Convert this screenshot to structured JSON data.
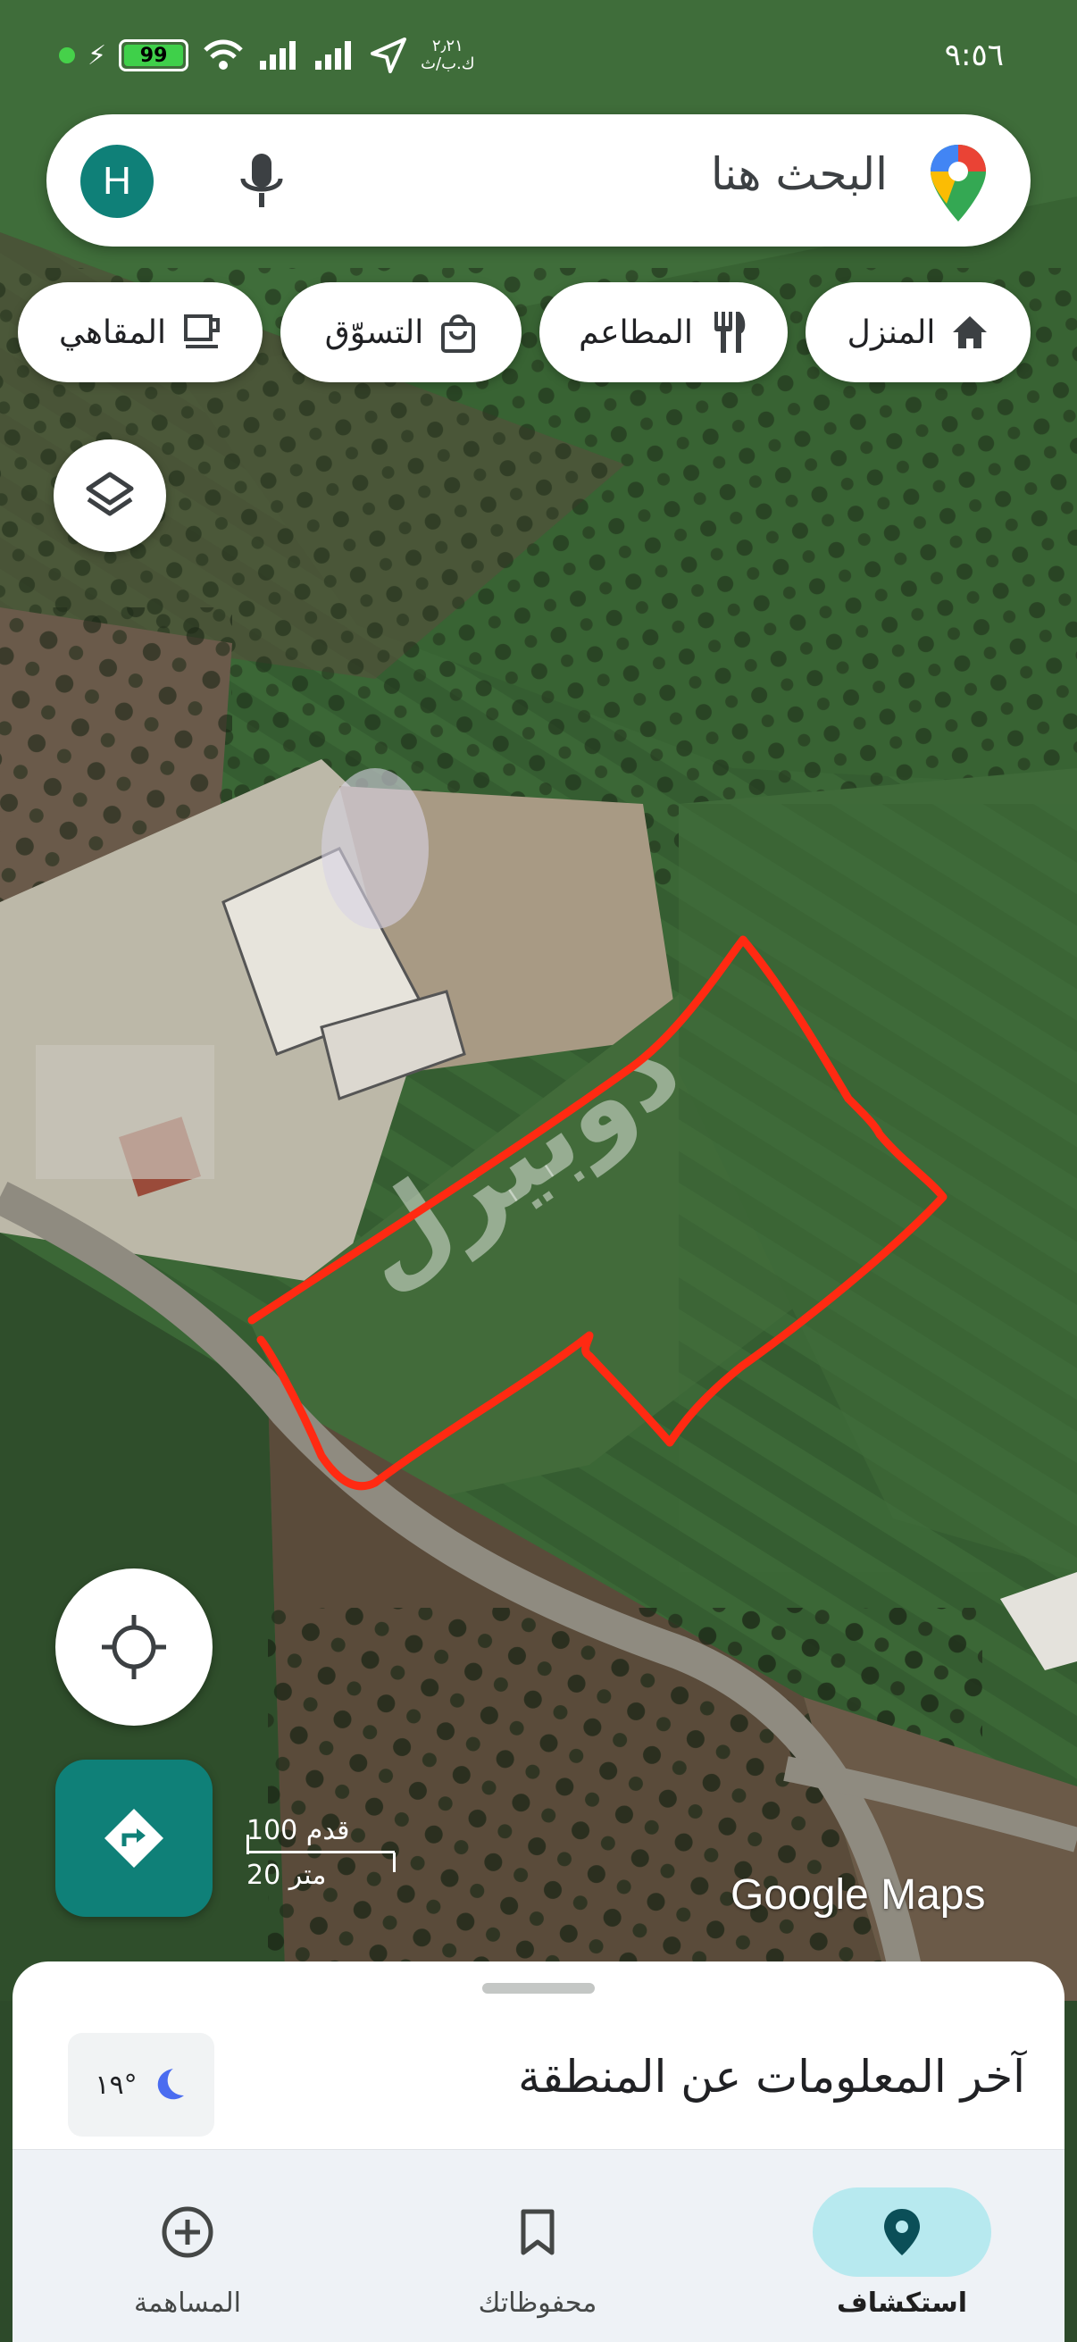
{
  "status_bar": {
    "time": "٩:٥٦",
    "battery": "99",
    "speed_top": "٢٫٢١",
    "speed_bottom": "ك.ب/ث"
  },
  "search": {
    "placeholder": "البحث هنا",
    "avatar_letter": "H"
  },
  "chips": [
    {
      "label": "المنزل",
      "icon": "home-icon"
    },
    {
      "label": "المطاعم",
      "icon": "restaurant-icon"
    },
    {
      "label": "التسوّق",
      "icon": "shopping-bag-icon"
    },
    {
      "label": "المقاهي",
      "icon": "coffee-icon"
    }
  ],
  "map": {
    "scale_feet": "100 قدم",
    "scale_meters": "20 متر",
    "attribution": "Google Maps",
    "overlay_watermark": "دوبيزل"
  },
  "sheet": {
    "title": "آخر المعلومات عن المنطقة",
    "weather_temp": "١٩°",
    "weather_icon": "moon-icon"
  },
  "nav": {
    "explore": "استكشاف",
    "saved": "محفوظاتك",
    "contribute": "المساهمة"
  },
  "colors": {
    "accent": "#0f8078",
    "active_nav": "#b7e9ef",
    "outline": "#ff2a12"
  }
}
